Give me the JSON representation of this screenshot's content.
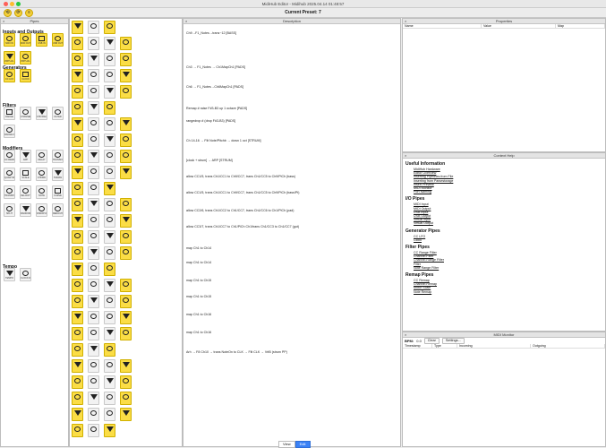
{
  "window": {
    "title": "MidiHub Editor - Midihub 2025.04.14 01:48:57"
  },
  "toolbar": {
    "preset_title": "Current Preset: 7",
    "buttons": [
      "icon-a",
      "icon-b",
      "icon-c"
    ]
  },
  "pipes_panel": {
    "title": "Pipes",
    "sections": [
      {
        "name": "Inputs and Outputs",
        "items": [
          "MIDI IN",
          "MIDI OUT",
          "USB IN",
          "USB OUT",
          "VIRTUAL IN",
          "VIRTUAL OUT"
        ]
      },
      {
        "name": "Generators",
        "items": [
          "CC LFO",
          "CLOCK"
        ]
      },
      {
        "name": "Filters",
        "items": [
          "RANGE",
          "CHANNEL",
          "CHN RANGE",
          "FILTER",
          "RANGE FILTER"
        ]
      },
      {
        "name": "Modifiers",
        "items": [
          "CC REMAP",
          "ARP",
          "DELAY",
          "TRANSFORM",
          "QUANTIZE",
          "SCALE",
          "CHORD",
          "HUMAN",
          "TRANSPOSE",
          "VELOCITY",
          "NOTE",
          "CURVE",
          "SPLIT",
          "RANDOM",
          "DISPATCH",
          "REROUTE"
        ]
      },
      {
        "name": "Tempo",
        "items": [
          "TEMPO",
          "CLOCK DIV"
        ]
      }
    ]
  },
  "description_panel": {
    "title": "Description",
    "lines": [
      "Ch9→F1_Notes→trans−12 [BASS]",
      "Ch3 → F1_Notes → Ch1MapCh1 [PADS]",
      "Ch6 → F1_Notes→Ch6MapCh1 [PADS]",
      "Remap   # raise F#3-B3 up 1 octave [PADS]",
      "rangedrop   # (drop F#3-B3) [PADS]",
      "Ch 14-16 → Filt Note/Pitchb → down 1 oct [STRUM]",
      "[clock + strum] → ARP [STRUM]",
      "allow CC1/5, trans Ch1/CC1 to Ch9/CC7, trans Ch1/CC5 to Ch9/PiCh (bass)",
      "allow CC1/5, trans Ch1/CC1 to Ch9/CC7, trans Ch1/CC5 to Ch9/PiCh (bass/Pt)",
      "allow CC2/6, trans Ch1/CC2 to Ch1/CC7, trans Ch1/CC6 to Ch1/PiCh (pad)",
      "allow CC3/7, trans Ch1/CC7 to Ch1/PiCh Ch1/trans Ch1/CC3 to Ch1/CC7 (gut)",
      "map Ch1 to Ch14",
      "map Ch1 to Ch14",
      "map Ch1 to Ch15",
      "map Ch1 to Ch15",
      "map Ch1 to Ch16",
      "map Ch1 to Ch16",
      "Arh → F8 Ch10 → trans NoteOn to CLK → Filt CLK → VrtB (strum PP)"
    ]
  },
  "properties_panel": {
    "title": "Properties",
    "columns": [
      "Name",
      "Value",
      "Map"
    ]
  },
  "context_help": {
    "title": "Context Help",
    "groups": [
      {
        "heading": "Useful Information",
        "links": [
          "MidiHub Hardware",
          "Editor Overview",
          "Inserting Pipelines from File",
          "Inserting from Parsestorage",
          "Insert Preview",
          "MIDI Monitor",
          "Port Naming"
        ]
      },
      {
        "heading": "I/O Pipes",
        "links": [
          "MIDI Input",
          "MIDI Output",
          "USB Input",
          "USB Output",
          "Virtual Input",
          "Virtual Output"
        ]
      },
      {
        "heading": "Generator Pipes",
        "links": [
          "CC LFO",
          "Clock"
        ]
      },
      {
        "heading": "Filter Pipes",
        "links": [
          "CC Range Filter",
          "Channel Filter",
          "Channel Range Filter",
          "Filter",
          "Note Range Filter"
        ]
      },
      {
        "heading": "Remap Pipes",
        "links": [
          "CC Remap",
          "Channel Remap",
          "Motor Scale",
          "Note Remap"
        ]
      }
    ]
  },
  "midi_monitor": {
    "title": "MIDI Monitor",
    "bpm_label": "BPM:",
    "bpm_value": "0.0",
    "clear_label": "Clear",
    "settings_label": "Settings...",
    "columns": [
      "Timestamp",
      "Type",
      "Incoming",
      "Outgoing"
    ]
  },
  "view_tabs": {
    "view": "View",
    "edit": "Edit"
  }
}
